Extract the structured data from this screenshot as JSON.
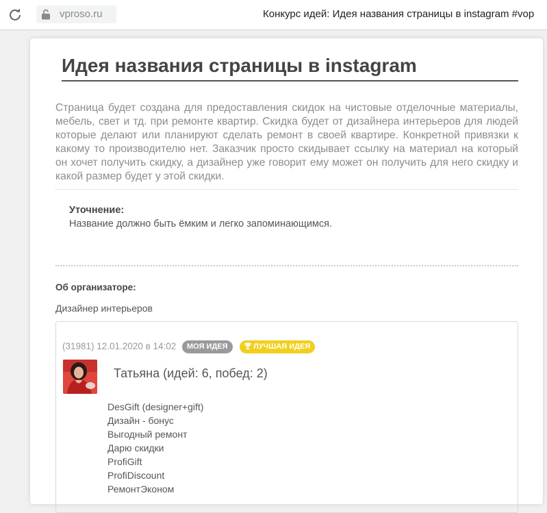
{
  "browser": {
    "domain": "vproso.ru",
    "page_title": "Конкурс идей: Идея названия страницы в instagram #vop"
  },
  "page": {
    "heading": "Идея названия страницы в instagram",
    "description": "Страница будет создана для предоставления скидок на чистовые отделочные материалы, мебель, свет и тд. при ремонте квартир. Скидка будет от дизайнера интерьеров для людей которые делают или планируют сделать ремонт в своей квартире. Конкретной привязки к какому то производителю нет. Заказчик просто скидывает ссылку на материал на который он хочет получить скидку, а дизайнер уже говорит ему может он получить для него скидку и какой размер будет у этой скидки.",
    "clarification_title": "Уточнение:",
    "clarification_text": "Название должно быть ёмким и легко запоминающимся.",
    "organizer_title": "Об организаторе:",
    "organizer_text": "Дизайнер интерьеров"
  },
  "idea": {
    "meta": "(31981) 12.01.2020 в 14:02",
    "badge_mine": "МОЯ ИДЕЯ",
    "badge_best": "ЛУЧШАЯ ИДЕЯ",
    "author": "Татьяна (идей: 6, побед: 2)",
    "names": [
      "DesGift (designer+gift)",
      "Дизайн - бонус",
      "Выгодный ремонт",
      "Дарю скидки",
      "ProfiGift",
      "ProfiDiscount",
      "РемонтЭконом"
    ]
  },
  "icons": {
    "reload": "reload-icon",
    "lock": "lock-icon",
    "trophy": "trophy-icon"
  },
  "colors": {
    "badge_mine": "#9a9a9a",
    "badge_best": "#f2cf1d"
  }
}
